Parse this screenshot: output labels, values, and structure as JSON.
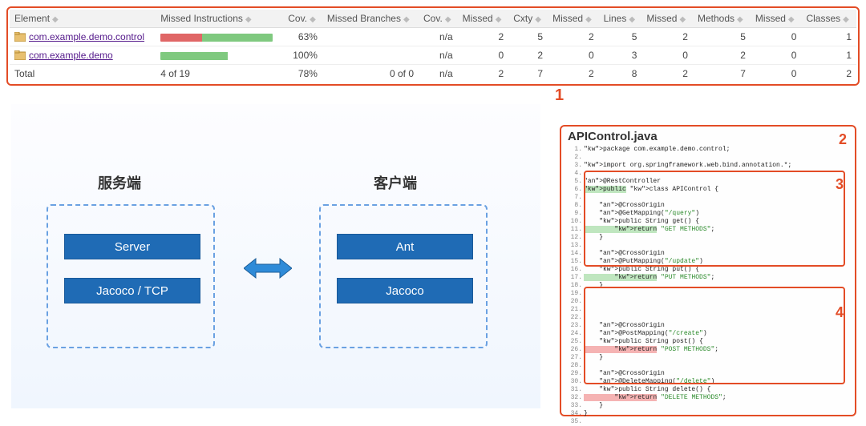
{
  "coverage_table": {
    "headers": [
      "Element",
      "Missed Instructions",
      "Cov.",
      "Missed Branches",
      "Cov.",
      "Missed",
      "Cxty",
      "Missed",
      "Lines",
      "Missed",
      "Methods",
      "Missed",
      "Classes"
    ],
    "rows": [
      {
        "element": "com.example.demo.control",
        "bar_miss_pct": 37,
        "bar_cov_pct": 63,
        "cov1": "63%",
        "mb": "",
        "cov2": "n/a",
        "missed1": "2",
        "cxty": "5",
        "missed2": "2",
        "lines": "5",
        "missed3": "2",
        "methods": "5",
        "missed4": "0",
        "classes": "1"
      },
      {
        "element": "com.example.demo",
        "bar_miss_pct": 0,
        "bar_cov_pct": 60,
        "cov1": "100%",
        "mb": "",
        "cov2": "n/a",
        "missed1": "0",
        "cxty": "2",
        "missed2": "0",
        "lines": "3",
        "missed3": "0",
        "methods": "2",
        "missed4": "0",
        "classes": "1"
      }
    ],
    "total": {
      "label": "Total",
      "instr": "4 of 19",
      "cov1": "78%",
      "mb": "0 of 0",
      "cov2": "n/a",
      "missed1": "2",
      "cxty": "7",
      "missed2": "2",
      "lines": "8",
      "missed3": "2",
      "methods": "7",
      "missed4": "0",
      "classes": "2"
    }
  },
  "annotations": {
    "n1": "1",
    "n2": "2",
    "n3": "3",
    "n4": "4"
  },
  "arch": {
    "server_title": "服务端",
    "client_title": "客户端",
    "server_box": {
      "row1": "Server",
      "row2": "Jacoco  / TCP"
    },
    "client_box": {
      "row1": "Ant",
      "row2": "Jacoco"
    }
  },
  "code_panel": {
    "title": "APIControl.java",
    "lines": [
      {
        "n": 1,
        "cls": "",
        "text": "package com.example.demo.control;"
      },
      {
        "n": 2,
        "cls": "",
        "text": ""
      },
      {
        "n": 3,
        "cls": "",
        "text": "import org.springframework.web.bind.annotation.*;"
      },
      {
        "n": 4,
        "cls": "",
        "text": ""
      },
      {
        "n": 5,
        "cls": "an",
        "text": "@RestController"
      },
      {
        "n": 6,
        "cls": "hl-g",
        "text": "public class APIControl {"
      },
      {
        "n": 7,
        "cls": "",
        "text": ""
      },
      {
        "n": 8,
        "cls": "an",
        "text": "    @CrossOrigin"
      },
      {
        "n": 9,
        "cls": "an",
        "text": "    @GetMapping(\"/query\")"
      },
      {
        "n": 10,
        "cls": "",
        "text": "    public String get() {"
      },
      {
        "n": 11,
        "cls": "hl-g",
        "text": "        return \"GET METHODS\";"
      },
      {
        "n": 12,
        "cls": "",
        "text": "    }"
      },
      {
        "n": 13,
        "cls": "",
        "text": ""
      },
      {
        "n": 14,
        "cls": "an",
        "text": "    @CrossOrigin"
      },
      {
        "n": 15,
        "cls": "an",
        "text": "    @PutMapping(\"/update\")"
      },
      {
        "n": 16,
        "cls": "",
        "text": "    public String put() {"
      },
      {
        "n": 17,
        "cls": "hl-g",
        "text": "        return \"PUT METHODS\";"
      },
      {
        "n": 18,
        "cls": "",
        "text": "    }"
      },
      {
        "n": 19,
        "cls": "",
        "text": ""
      },
      {
        "n": 20,
        "cls": "",
        "text": ""
      },
      {
        "n": 21,
        "cls": "",
        "text": ""
      },
      {
        "n": 22,
        "cls": "",
        "text": ""
      },
      {
        "n": 23,
        "cls": "an",
        "text": "    @CrossOrigin"
      },
      {
        "n": 24,
        "cls": "an",
        "text": "    @PostMapping(\"/create\")"
      },
      {
        "n": 25,
        "cls": "",
        "text": "    public String post() {"
      },
      {
        "n": 26,
        "cls": "hl-r",
        "text": "        return \"POST METHODS\";"
      },
      {
        "n": 27,
        "cls": "",
        "text": "    }"
      },
      {
        "n": 28,
        "cls": "",
        "text": ""
      },
      {
        "n": 29,
        "cls": "an",
        "text": "    @CrossOrigin"
      },
      {
        "n": 30,
        "cls": "an",
        "text": "    @DeleteMapping(\"/delete\")"
      },
      {
        "n": 31,
        "cls": "",
        "text": "    public String delete() {"
      },
      {
        "n": 32,
        "cls": "hl-r",
        "text": "        return \"DELETE METHODS\";"
      },
      {
        "n": 33,
        "cls": "",
        "text": "    }"
      },
      {
        "n": 34,
        "cls": "",
        "text": "}"
      },
      {
        "n": 35,
        "cls": "",
        "text": ""
      }
    ]
  }
}
